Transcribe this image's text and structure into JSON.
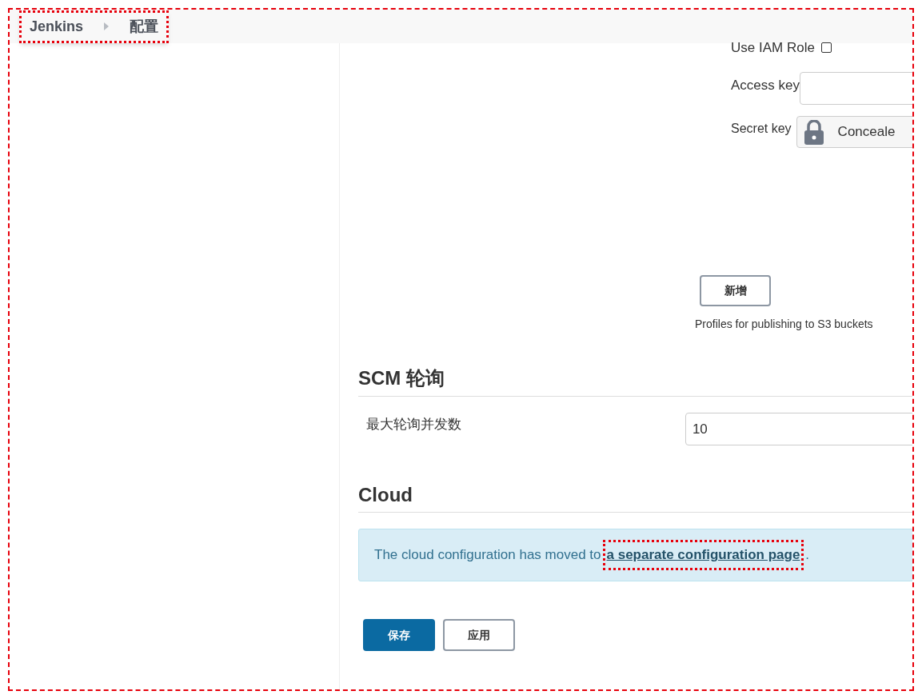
{
  "breadcrumb": {
    "highlighted": true,
    "items": [
      {
        "label": "Jenkins"
      },
      {
        "label": "配置"
      }
    ]
  },
  "s3_profile": {
    "use_iam_role": {
      "label": "Use IAM Role",
      "checked": false
    },
    "access_key": {
      "label": "Access key"
    },
    "secret_key": {
      "label": "Secret key",
      "value": "Conceale"
    },
    "add_button": "新增",
    "help": "Profiles for publishing to S3 buckets"
  },
  "scm_polling": {
    "title": "SCM 轮询",
    "fields": [
      {
        "label": "最大轮询并发数",
        "value": "10"
      }
    ]
  },
  "cloud": {
    "title": "Cloud",
    "notice": {
      "text": "The cloud configuration has moved to",
      "link": {
        "label": "a separate configuration page",
        "highlighted": true
      },
      "suffix": "."
    }
  },
  "buttons": [
    {
      "label": "保存",
      "kind": "primary"
    },
    {
      "label": "应用",
      "kind": "secondary"
    }
  ]
}
